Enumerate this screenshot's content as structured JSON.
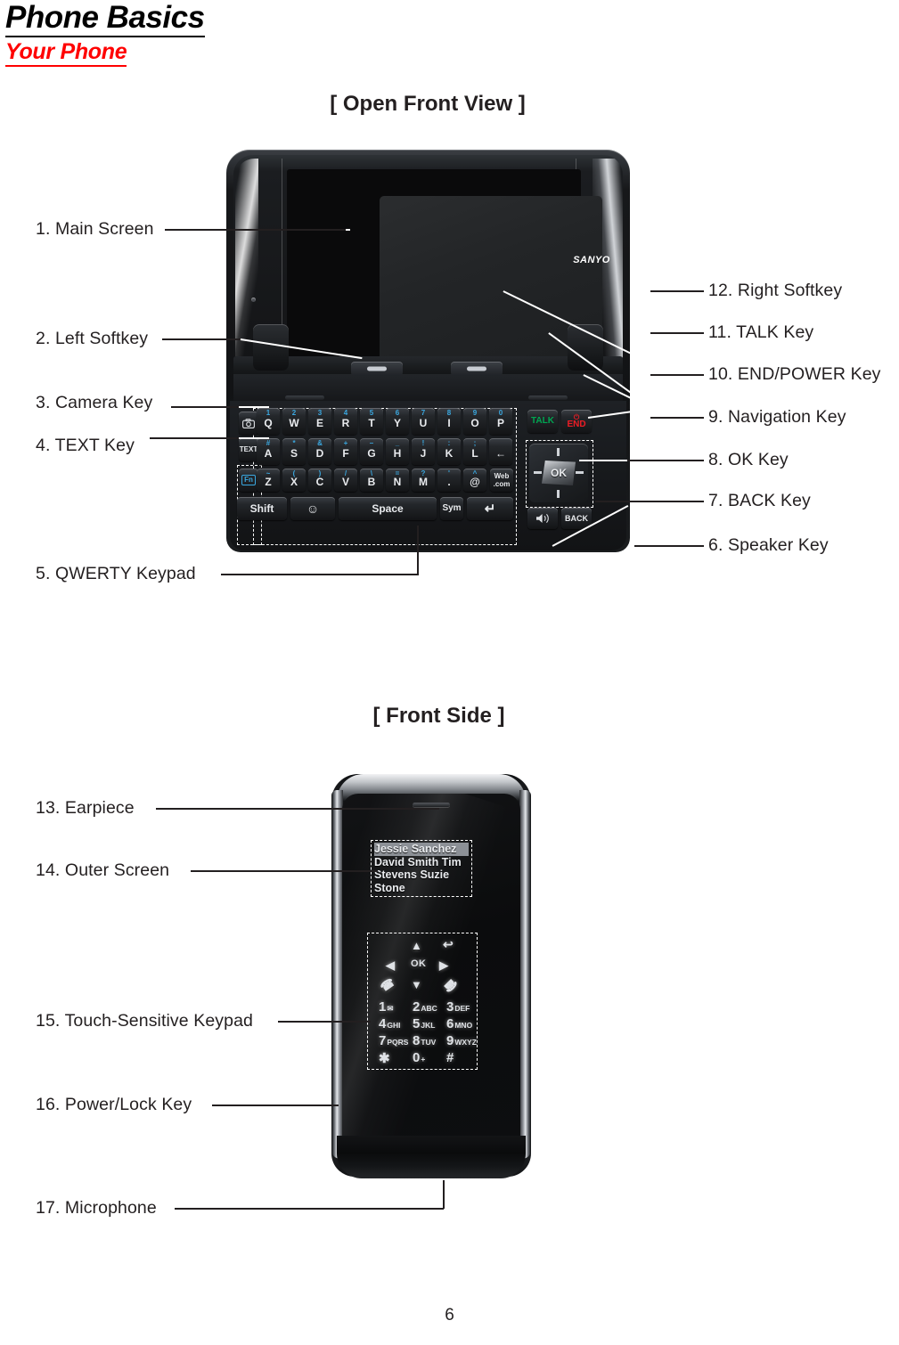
{
  "document": {
    "title": "Phone Basics",
    "section": "Your Phone",
    "page_number": "6"
  },
  "figures": {
    "open_front": {
      "caption": "[ Open Front View ]",
      "brand": "SANYO",
      "callouts_left": [
        {
          "n": "1.",
          "label": "1. Main Screen"
        },
        {
          "n": "2.",
          "label": "2. Left Softkey"
        },
        {
          "n": "3.",
          "label": "3. Camera Key"
        },
        {
          "n": "4.",
          "label": "4. TEXT Key"
        },
        {
          "n": "5.",
          "label": "5. QWERTY Keypad"
        }
      ],
      "callouts_right": [
        {
          "n": "12.",
          "label": "12. Right Softkey"
        },
        {
          "n": "11.",
          "label": "11. TALK Key"
        },
        {
          "n": "10.",
          "label": "10. END/POWER Key"
        },
        {
          "n": "9.",
          "label": "9. Navigation Key"
        },
        {
          "n": "8.",
          "label": "8. OK Key"
        },
        {
          "n": "7.",
          "label": "7. BACK Key"
        },
        {
          "n": "6.",
          "label": "6. Speaker Key"
        }
      ],
      "keyboard": {
        "row1": [
          {
            "alt": "1",
            "main": "Q"
          },
          {
            "alt": "2",
            "main": "W"
          },
          {
            "alt": "3",
            "main": "E"
          },
          {
            "alt": "4",
            "main": "R"
          },
          {
            "alt": "5",
            "main": "T"
          },
          {
            "alt": "6",
            "main": "Y"
          },
          {
            "alt": "7",
            "main": "U"
          },
          {
            "alt": "8",
            "main": "I"
          },
          {
            "alt": "9",
            "main": "O"
          },
          {
            "alt": "0",
            "main": "P"
          }
        ],
        "row2": [
          {
            "alt": "#",
            "main": "A"
          },
          {
            "alt": "*",
            "main": "S"
          },
          {
            "alt": "&",
            "main": "D"
          },
          {
            "alt": "+",
            "main": "F"
          },
          {
            "alt": "–",
            "main": "G"
          },
          {
            "alt": "_",
            "main": "H"
          },
          {
            "alt": "!",
            "main": "J"
          },
          {
            "alt": ":",
            "main": "K"
          },
          {
            "alt": ";",
            "main": "L"
          },
          {
            "alt": "",
            "main": "←"
          }
        ],
        "row3": [
          {
            "alt": "~",
            "main": "Z"
          },
          {
            "alt": "(",
            "main": "X"
          },
          {
            "alt": ")",
            "main": "C"
          },
          {
            "alt": "/",
            "main": "V"
          },
          {
            "alt": "\\",
            "main": "B"
          },
          {
            "alt": "=",
            "main": "N"
          },
          {
            "alt": "?",
            "main": "M"
          },
          {
            "alt": "'",
            "main": "."
          },
          {
            "alt": "^",
            "main": "@"
          }
        ],
        "web_key_top": "Web",
        "web_key_bottom": ".com",
        "row4": [
          {
            "main": "Shift"
          },
          {
            "main": "☺"
          },
          {
            "main": "Space"
          },
          {
            "main": "Sym"
          },
          {
            "main": "↵"
          }
        ],
        "fn_key": "Fn",
        "text_key": "TEXT",
        "talk_key": "TALK",
        "end_key": "END",
        "ok_key": "OK",
        "back_key": "BACK"
      }
    },
    "front_side": {
      "caption": "[ Front Side ]",
      "callouts": [
        {
          "n": "13.",
          "label": "13. Earpiece"
        },
        {
          "n": "14.",
          "label": "14. Outer Screen"
        },
        {
          "n": "15.",
          "label": "15. Touch-Sensitive Keypad"
        },
        {
          "n": "16.",
          "label": "16. Power/Lock Key"
        },
        {
          "n": "17.",
          "label": "17. Microphone"
        }
      ],
      "outer_screen_contacts": [
        "Jessie Sanchez",
        "David Smith",
        "Tim Stevens",
        "Suzie Stone"
      ],
      "touch_keypad": {
        "nav_up": "▲",
        "nav_left": "◀",
        "nav_right": "▶",
        "nav_down": "▼",
        "ok": "OK",
        "back": "↩",
        "talk": "✆",
        "end": "✆",
        "keys": [
          {
            "num": "1",
            "sub": "✉"
          },
          {
            "num": "2",
            "sub": "ABC"
          },
          {
            "num": "3",
            "sub": "DEF"
          },
          {
            "num": "4",
            "sub": "GHI"
          },
          {
            "num": "5",
            "sub": "JKL"
          },
          {
            "num": "6",
            "sub": "MNO"
          },
          {
            "num": "7",
            "sub": "PQRS"
          },
          {
            "num": "8",
            "sub": "TUV"
          },
          {
            "num": "9",
            "sub": "WXYZ"
          },
          {
            "num": "✱",
            "sub": ""
          },
          {
            "num": "0",
            "sub": "+"
          },
          {
            "num": "#",
            "sub": ""
          }
        ]
      }
    }
  },
  "colors": {
    "title": "#000000",
    "section": "#ff0000",
    "talk": "#00a651",
    "end": "#ed1c24",
    "alt_key": "#3aa8e0",
    "text": "#231f20"
  }
}
